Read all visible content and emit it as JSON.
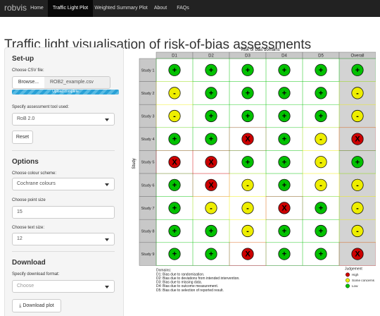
{
  "navbar": {
    "brand": "robvis",
    "items": [
      {
        "label": "Home",
        "active": false
      },
      {
        "label": "Traffic Light Plot",
        "active": true
      },
      {
        "label": "Weighted Summary Plot",
        "active": false
      },
      {
        "label": "About",
        "active": false
      },
      {
        "label": "FAQs",
        "active": false
      }
    ]
  },
  "page_title": "Traffic light visualisation of risk-of-bias assessments",
  "setup": {
    "heading": "Set-up",
    "csv_label": "Choose CSV file:",
    "browse_label": "Browse...",
    "file_name": "ROB2_example.csv",
    "upload_status": "Upload complete",
    "upload_progress": 1.0,
    "tool_label": "Specify assessment tool used:",
    "tool_value": "RoB 2.0",
    "reset_label": "Reset"
  },
  "options": {
    "heading": "Options",
    "colour_label": "Choose colour scheme:",
    "colour_value": "Cochrane colours",
    "point_label": "Choose point size",
    "point_value": "15",
    "text_label": "Choose text size:",
    "text_value": "12"
  },
  "download": {
    "heading": "Download",
    "format_label": "Specify download format:",
    "format_placeholder": "Choose",
    "button_label": "Download plot"
  },
  "colors": {
    "high": "#cc0000",
    "some": "#eeee00",
    "low": "#02c100",
    "navbar": "#222222",
    "progress": "#2aa1d6"
  },
  "chart_data": {
    "type": "table",
    "title": "Risk of bias domains",
    "ylabel": "Study",
    "columns": [
      "D1",
      "D2",
      "D3",
      "D4",
      "D5",
      "Overall"
    ],
    "rows": [
      "Study 1",
      "Study 2",
      "Study 3",
      "Study 4",
      "Study 5",
      "Study 6",
      "Study 7",
      "Study 8",
      "Study 9"
    ],
    "judgements": [
      [
        "+",
        "+",
        "+",
        "+",
        "+",
        "+"
      ],
      [
        "-",
        "+",
        "+",
        "+",
        "+",
        "-"
      ],
      [
        "-",
        "+",
        "+",
        "+",
        "+",
        "-"
      ],
      [
        "+",
        "+",
        "X",
        "+",
        "-",
        "X"
      ],
      [
        "X",
        "X",
        "+",
        "+",
        "-",
        "+"
      ],
      [
        "+",
        "X",
        "-",
        "+",
        "-",
        "-"
      ],
      [
        "+",
        "-",
        "-",
        "X",
        "+",
        "-"
      ],
      [
        "+",
        "+",
        "-",
        "+",
        "+",
        "-"
      ],
      [
        "+",
        "+",
        "X",
        "+",
        "+",
        "X"
      ]
    ],
    "domain_notes": {
      "heading": "Domains:",
      "lines": [
        "D1: Bias due to randomisation.",
        "D2: Bias due to deviations from intended intervention.",
        "D3: Bias due to missing data.",
        "D4: Bias due to outcome measurement.",
        "D5: Bias due to selection of reported result."
      ]
    },
    "legend": {
      "title": "Judgement",
      "items": [
        {
          "symbol": "X",
          "label": "High"
        },
        {
          "symbol": "-",
          "label": "Some concerns"
        },
        {
          "symbol": "+",
          "label": "Low"
        }
      ]
    }
  }
}
